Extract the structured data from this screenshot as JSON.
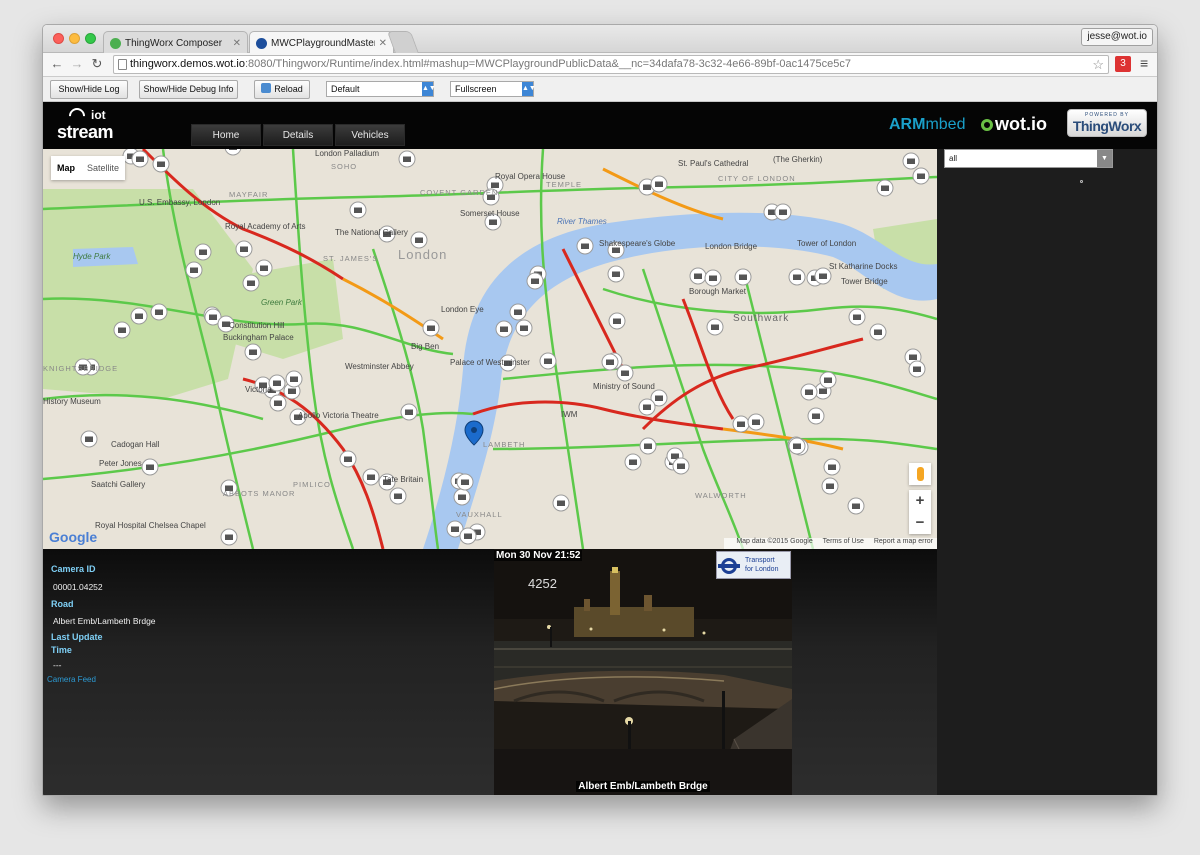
{
  "browser": {
    "tabs": [
      {
        "label": "ThingWorx Composer",
        "favicon_color": "#4caf50"
      },
      {
        "label": "MWCPlaygroundMaster",
        "favicon_color": "#1e4f9c"
      }
    ],
    "profile": "jesse@wot.io",
    "url_host": "thingworx.demos.wot.io",
    "url_rest": ":8080/Thingworx/Runtime/index.html#mashup=MWCPlaygroundPublicData&__nc=34dafa78-3c32-4e66-89bf-0ac1475ce5c7",
    "ext_badge": "3"
  },
  "controls": {
    "log_button": "Show/Hide Log",
    "debug_button": "Show/Hide Debug Info",
    "reload_button": "Reload",
    "theme_select": "Default",
    "view_select": "Fullscreen"
  },
  "header": {
    "logo_small": "iot",
    "logo_big": "stream",
    "nav": [
      "Home",
      "Details",
      "Vehicles"
    ],
    "arm_brand": "ARM",
    "arm_sub": "mbed",
    "wotio": "wot.io",
    "tw_powered": "POWERED BY",
    "tw_brand": "ThingWorx"
  },
  "map": {
    "type_map": "Map",
    "type_satellite": "Satellite",
    "google": "Google",
    "attribution": "Map data ©2015 Google",
    "terms": "Terms of Use",
    "report": "Report a map error",
    "zoom_in": "+",
    "zoom_out": "−",
    "labels": {
      "london_palladium": "London Palladium",
      "soho": "SOHO",
      "royal_opera": "Royal Opera House",
      "covent_garden": "COVENT GARDEN",
      "temple": "TEMPLE",
      "st_pauls": "St. Paul's Cathedral",
      "gherkin": "(The Gherkin)",
      "city_of_london": "CITY OF LONDON",
      "mayfair": "MAYFAIR",
      "us_embassy": "U.S. Embassy, London",
      "royal_academy": "Royal Academy of Arts",
      "national_gallery": "The National Gallery",
      "somerset": "Somerset House",
      "river_thames": "River Thames",
      "shakespeare": "Shakespeare's Globe",
      "london_bridge": "London Bridge",
      "tower_of_london": "Tower of London",
      "hyde_park": "Hyde Park",
      "st_james": "ST. JAMES'S",
      "london": "London",
      "st_katharine": "St Katharine Docks",
      "tower_bridge": "Tower Bridge",
      "green_park": "Green Park",
      "borough_market": "Borough Market",
      "london_eye": "London Eye",
      "southwark": "Southwark",
      "constitution_hill": "Constitution Hill",
      "buckingham": "Buckingham Palace",
      "big_ben": "Big Ben",
      "palace_westminster": "Palace of Westminster",
      "westminster_abbey": "Westminster Abbey",
      "knightsbridge": "KNIGHTSBRIDGE",
      "victoria": "Victoria",
      "ministry_of_sound": "Ministry of Sound",
      "history_museum": "History Museum",
      "apollo": "Apollo Victoria Theatre",
      "iwm": "IWM",
      "lambeth": "LAMBETH",
      "cadogan_hall": "Cadogan Hall",
      "peter_jones": "Peter Jones",
      "saatchi": "Saatchi Gallery",
      "pimlico": "PIMLICO",
      "abbots_manor": "ABBOTS MANOR",
      "tate_britain": "Tate Britain",
      "walworth": "WALWORTH",
      "vauxhall": "VAUXHALL",
      "royal_hospital": "Royal Hospital Chelsea Chapel"
    }
  },
  "filter": {
    "value": "all"
  },
  "camera": {
    "camera_id_label": "Camera ID",
    "camera_id": "00001.04252",
    "road_label": "Road",
    "road": "Albert Emb/Lambeth Brdge",
    "last_update_label": "Last Update",
    "time_label": "Time",
    "time": "---",
    "feed_link": "Camera Feed",
    "timestamp": "Mon 30 Nov 21:52",
    "cam_number": "4252",
    "tfl_line1": "Transport",
    "tfl_line2": "for London",
    "caption": "Albert Emb/Lambeth Brdge"
  },
  "colors": {
    "accent_blue": "#7fd0f6",
    "link_blue": "#2c9ad3",
    "arm_blue": "#1aa0c9",
    "wotio_green": "#6ac045",
    "traffic_green": "#5cc94a",
    "traffic_red": "#d8281e",
    "traffic_orange": "#f39a16",
    "river": "#a8c8f0"
  }
}
